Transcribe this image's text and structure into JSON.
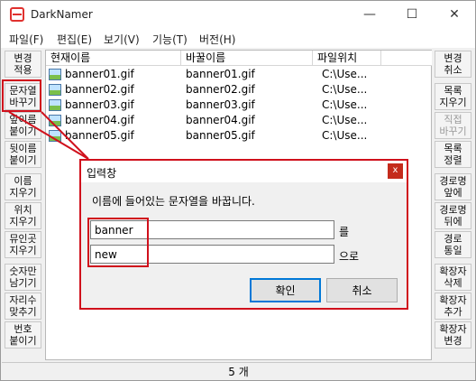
{
  "window": {
    "title": "DarkNamer",
    "minimize_glyph": "—",
    "maximize_glyph": "☐",
    "close_glyph": "✕"
  },
  "menu": [
    "파일(F)",
    "편집(E)",
    "보기(V)",
    "기능(T)",
    "버전(H)"
  ],
  "left_buttons": [
    {
      "label": "변경\n적용",
      "enabled": true
    },
    {
      "label": "문자열\n바꾸기",
      "enabled": true
    },
    {
      "label": "앞이름\n붙이기",
      "enabled": true
    },
    {
      "label": "뒷이름\n붙이기",
      "enabled": true
    },
    {
      "label": "이름\n지우기",
      "enabled": true
    },
    {
      "label": "위치\n지우기",
      "enabled": true
    },
    {
      "label": "뮤인곳\n지우기",
      "enabled": true
    },
    {
      "label": "숫자만\n남기기",
      "enabled": true
    },
    {
      "label": "자리수\n맞추기",
      "enabled": true
    },
    {
      "label": "번호\n붙이기",
      "enabled": true
    }
  ],
  "right_buttons": [
    {
      "label": "변경\n취소",
      "enabled": true
    },
    {
      "label": "목록\n지우기",
      "enabled": true
    },
    {
      "label": "직접\n바꾸기",
      "enabled": false
    },
    {
      "label": "목록\n정렬",
      "enabled": true
    },
    {
      "label": "경로명\n앞에",
      "enabled": true
    },
    {
      "label": "경로명\n뒤에",
      "enabled": true
    },
    {
      "label": "경로\n통일",
      "enabled": true
    },
    {
      "label": "확장자\n삭제",
      "enabled": true
    },
    {
      "label": "확장자\n추가",
      "enabled": true
    },
    {
      "label": "확장자\n변경",
      "enabled": true
    }
  ],
  "table": {
    "columns": [
      "현재이름",
      "바꿀이름",
      "파일위치"
    ],
    "rows": [
      {
        "current": "banner01.gif",
        "new": "banner01.gif",
        "path": "C:\\Use..."
      },
      {
        "current": "banner02.gif",
        "new": "banner02.gif",
        "path": "C:\\Use..."
      },
      {
        "current": "banner03.gif",
        "new": "banner03.gif",
        "path": "C:\\Use..."
      },
      {
        "current": "banner04.gif",
        "new": "banner04.gif",
        "path": "C:\\Use..."
      },
      {
        "current": "banner05.gif",
        "new": "banner05.gif",
        "path": "C:\\Use..."
      }
    ]
  },
  "status": {
    "count_text": "5 개"
  },
  "dialog": {
    "title": "입력창",
    "close_glyph": "x",
    "prompt": "이름에 들어있는 문자열을 바꿉니다.",
    "find_value": "banner",
    "find_suffix": "를",
    "replace_value": "new",
    "replace_suffix": "으로",
    "ok_label": "확인",
    "cancel_label": "취소"
  },
  "annotation_color": "#d0101c"
}
